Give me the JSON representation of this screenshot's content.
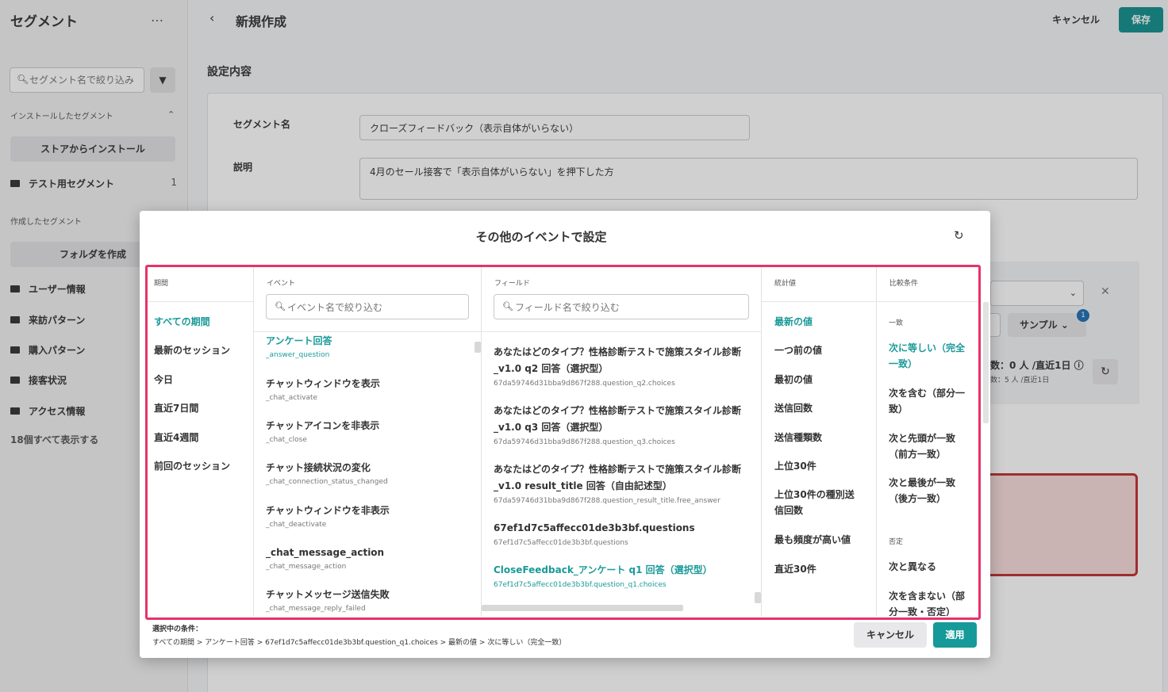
{
  "sidebar": {
    "title": "セグメント",
    "more": "…",
    "search_placeholder": "セグメント名で絞り込み",
    "installed_section": "インストールしたセグメント",
    "store_button": "ストアからインストール",
    "installed_items": [
      {
        "label": "テスト用セグメント",
        "count": "1"
      }
    ],
    "created_section": "作成したセグメント",
    "create_folder_button": "フォルダを作成",
    "folders": [
      "ユーザー情報",
      "来訪パターン",
      "購入パターン",
      "接客状況",
      "アクセス情報"
    ],
    "show_all": "18個すべて表示する"
  },
  "header": {
    "back": "‹",
    "title": "新規作成",
    "cancel": "キャンセル",
    "save": "保存"
  },
  "form": {
    "section_title": "設定内容",
    "name_label": "セグメント名",
    "name_value": "クローズフィードバック（表示自体がいらない）",
    "desc_label": "説明",
    "desc_value": "4月のセール接客で「表示自体がいらない」を押下した方",
    "sample_label": "サンプル",
    "badge_count": "1",
    "count_text": "数：0 人 /直近1日",
    "count_sub": "数：5 人 /直近1日"
  },
  "modal": {
    "title": "その他のイベントで設定",
    "columns": {
      "period": {
        "header": "期間",
        "options": [
          "すべての期間",
          "最新のセッション",
          "今日",
          "直近7日間",
          "直近4週間",
          "前回のセッション"
        ],
        "selected": "すべての期間"
      },
      "event": {
        "header": "イベント",
        "placeholder": "イベント名で絞り込む",
        "items": [
          {
            "label": "アンケート回答",
            "key": "_answer_question",
            "selected": true
          },
          {
            "label": "チャットウィンドウを表示",
            "key": "_chat_activate"
          },
          {
            "label": "チャットアイコンを非表示",
            "key": "_chat_close"
          },
          {
            "label": "チャット接続状況の変化",
            "key": "_chat_connection_status_changed"
          },
          {
            "label": "チャットウィンドウを非表示",
            "key": "_chat_deactivate"
          },
          {
            "label": "_chat_message_action",
            "key": "_chat_message_action"
          },
          {
            "label": "チャットメッセージ送信失敗",
            "key": "_chat_message_reply_failed"
          }
        ]
      },
      "field": {
        "header": "フィールド",
        "placeholder": "フィールド名で絞り込む",
        "items": [
          {
            "line1": "あなたはどのタイプ？性格診断テストで施策スタイル診断",
            "line2": "_v1.0 q2 回答（選択型）",
            "key": "67da59746d31bba9d867f288.question_q2.choices"
          },
          {
            "line1": "あなたはどのタイプ？性格診断テストで施策スタイル診断",
            "line2": "_v1.0 q3 回答（選択型）",
            "key": "67da59746d31bba9d867f288.question_q3.choices"
          },
          {
            "line1": "あなたはどのタイプ？性格診断テストで施策スタイル診断",
            "line2": "_v1.0 result_title 回答（自由記述型）",
            "key": "67da59746d31bba9d867f288.question_result_title.free_answer"
          },
          {
            "line1": "67ef1d7c5affecc01de3b3bf.questions",
            "line2": "",
            "key": "67ef1d7c5affecc01de3b3bf.questions"
          },
          {
            "line1": "CloseFeedback_アンケート q1 回答（選択型）",
            "line2": "",
            "key": "67ef1d7c5affecc01de3b3bf.question_q1.choices",
            "selected": true
          }
        ]
      },
      "stat": {
        "header": "統計値",
        "options": [
          "最新の値",
          "一つ前の値",
          "最初の値",
          "送信回数",
          "送信種類数",
          "上位30件",
          "上位30件の種別送",
          "信回数",
          "最も頻度が高い値",
          "直近30件"
        ],
        "selected": "最新の値"
      },
      "compare": {
        "header": "比較条件",
        "group_match": "一致",
        "match": [
          {
            "l1": "次に等しい（完全",
            "l2": "一致）",
            "selected": true
          },
          {
            "l1": "次を含む（部分一",
            "l2": "致）"
          },
          {
            "l1": "次と先頭が一致",
            "l2": "（前方一致）"
          },
          {
            "l1": "次と最後が一致",
            "l2": "（後方一致）"
          }
        ],
        "group_negate": "否定",
        "negate": [
          {
            "l1": "次と異なる",
            "l2": ""
          },
          {
            "l1": "次を含まない（部",
            "l2": "分一致・否定）"
          }
        ]
      }
    },
    "footer": {
      "selected_label": "選択中の条件：",
      "selected_path": "すべての期間 > アンケート回答 > 67ef1d7c5affecc01de3b3bf.question_q1.choices > 最新の値 > 次に等しい（完全一致）",
      "cancel": "キャンセル",
      "apply": "適用"
    }
  },
  "colors": {
    "accent": "#169999",
    "highlight": "#e6336a",
    "error_border": "#c0302e"
  }
}
